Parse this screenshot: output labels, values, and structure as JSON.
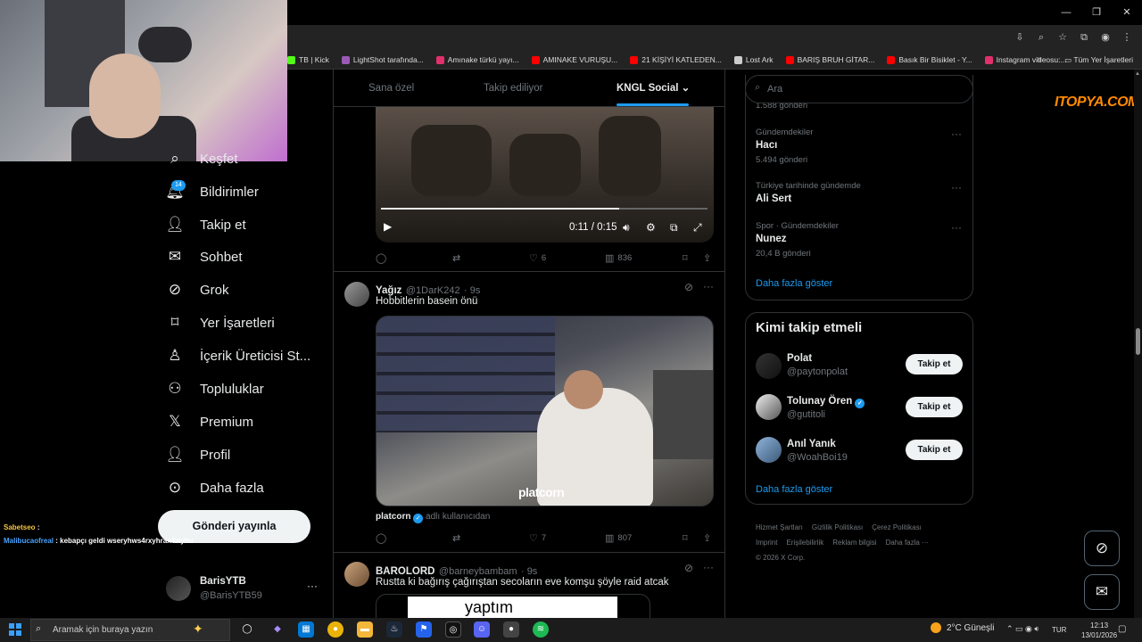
{
  "browser": {
    "window_controls": [
      "—",
      "❐",
      "✕"
    ],
    "bookmarks": [
      {
        "label": "TB | Kick",
        "color": "#53fc18"
      },
      {
        "label": "LightShot tarafında...",
        "color": "#9b59b6"
      },
      {
        "label": "Amınake türkü yayı...",
        "color": "#e1306c"
      },
      {
        "label": "AMINAKE VURUŞU...",
        "color": "#ff0000"
      },
      {
        "label": "21 KİŞİYİ KATLEDEN...",
        "color": "#ff0000"
      },
      {
        "label": "Lost Ark",
        "color": "#cccccc"
      },
      {
        "label": "BARIŞ BRUH GİTAR...",
        "color": "#ff0000"
      },
      {
        "label": "Basık Bir Bisiklet - Y...",
        "color": "#ff0000"
      },
      {
        "label": "Instagram videosu:...",
        "color": "#e1306c"
      }
    ],
    "bookmarks_more": "»",
    "all_bookmarks": "Tüm Yer İşaretleri"
  },
  "nav": {
    "items": [
      {
        "label": "Keşfet",
        "icon": "search-icon"
      },
      {
        "label": "Bildirimler",
        "icon": "bell-icon",
        "badge": "14"
      },
      {
        "label": "Takip et",
        "icon": "add-user-icon"
      },
      {
        "label": "Sohbet",
        "icon": "envelope-icon"
      },
      {
        "label": "Grok",
        "icon": "grok-icon"
      },
      {
        "label": "Yer İşaretleri",
        "icon": "bookmark-icon"
      },
      {
        "label": "İçerik Üreticisi St...",
        "icon": "creator-icon"
      },
      {
        "label": "Topluluklar",
        "icon": "communities-icon"
      },
      {
        "label": "Premium",
        "icon": "x-logo-icon"
      },
      {
        "label": "Profil",
        "icon": "person-icon"
      },
      {
        "label": "Daha fazla",
        "icon": "more-circle-icon"
      }
    ],
    "post_button": "Gönderi yayınla",
    "profile": {
      "name": "BarisYTB",
      "handle": "@BarisYTB59",
      "more": "···"
    }
  },
  "chat": [
    {
      "user": "Sabetseo",
      "message": ":"
    },
    {
      "user": "Malibucaofreal",
      "message": ": kebapçı geldi wseryhws4rxyhrax4wyhu"
    }
  ],
  "timeline": {
    "tabs": [
      "Sana özel",
      "Takip ediliyor",
      "KNGL Social"
    ],
    "active_tab_chevron": "⌄",
    "video1": {
      "time": "0:11 / 0:15",
      "progress": 0.73,
      "actions": {
        "replies": "",
        "reposts": "",
        "likes": "6",
        "views": "836"
      }
    },
    "tweet1": {
      "name": "Yağız",
      "handle": "@1DarK242",
      "time": "· 9s",
      "text": "Hobbitlerin basein önü",
      "video_watermark": "platcorn",
      "source_name": "platcorn",
      "source_suffix": "adlı kullanıcıdan",
      "actions": {
        "replies": "",
        "reposts": "",
        "likes": "7",
        "views": "807"
      }
    },
    "tweet2": {
      "name": "BAROLORD",
      "handle": "@barneybambam",
      "time": "· 9s",
      "text": "Rustta ki bağırış çağırıştan secoların eve komşu şöyle raid atcak",
      "card_word": "yaptım"
    }
  },
  "sidebar": {
    "search_placeholder": "Ara",
    "trends_partial_count": "1.588 gönderi",
    "trends": [
      {
        "category": "Gündemdekiler",
        "name": "Hacı",
        "count": "5.494 gönderi"
      },
      {
        "category": "Türkiye tarihinde gündemde",
        "name": "Ali Sert",
        "count": ""
      },
      {
        "category": "Spor · Gündemdekiler",
        "name": "Nunez",
        "count": "20,4 B gönderi"
      }
    ],
    "show_more": "Daha fazla göster",
    "follow_title": "Kimi takip etmeli",
    "follow": [
      {
        "name": "Polat",
        "handle": "@paytonpolat",
        "button": "Takip et",
        "verified": false
      },
      {
        "name": "Tolunay Ören",
        "handle": "@gutitoli",
        "button": "Takip et",
        "verified": true
      },
      {
        "name": "Anıl Yanık",
        "handle": "@WoahBoi19",
        "button": "Takip et",
        "verified": false
      }
    ],
    "follow_show_more": "Daha fazla göster",
    "footer": [
      "Hizmet Şartları",
      "Gizlilik Politikası",
      "Çerez Politikası",
      "Imprint",
      "Erişilebilirlik",
      "Reklam bilgisi",
      "Daha fazla ···",
      "© 2026 X Corp."
    ]
  },
  "overlay_watermark": "ITOPYA.COM",
  "taskbar": {
    "search_placeholder": "Aramak için buraya yazın",
    "weather": "2°C  Güneşli",
    "lang": "TUR",
    "time": "12:13",
    "date": "13/01/2026"
  }
}
